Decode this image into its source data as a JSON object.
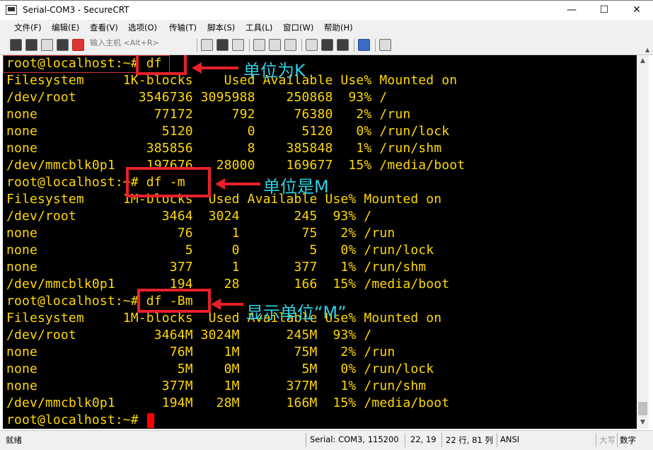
{
  "window": {
    "title": "Serial-COM3 - SecureCRT",
    "minimize_glyph": "—",
    "maximize_glyph": "☐",
    "close_glyph": "✕"
  },
  "menu": {
    "items": [
      {
        "label": "文件(F)"
      },
      {
        "label": "编辑(E)"
      },
      {
        "label": "查看(V)"
      },
      {
        "label": "选项(O)"
      },
      {
        "label": "传输(T)"
      },
      {
        "label": "脚本(S)"
      },
      {
        "label": "工具(L)"
      },
      {
        "label": "窗口(W)"
      },
      {
        "label": "帮助(H)"
      }
    ]
  },
  "toolbar": {
    "quick_connect_placeholder": "输入主机 <Alt+R>",
    "icons": [
      "connect-icon",
      "quick-connect-icon",
      "session-icon",
      "reconnect-icon",
      "disconnect-icon",
      "copy-icon",
      "paste-icon",
      "copy-paste-icon",
      "find-icon",
      "print-setup-icon",
      "print-icon",
      "session-options-icon",
      "global-options-icon",
      "keymap-icon",
      "help-icon",
      "sftp-icon"
    ]
  },
  "terminal": {
    "lines": [
      "root@localhost:~# df",
      "Filesystem     1K-blocks    Used Available Use% Mounted on",
      "/dev/root        3546736 3095988    250868  93% /",
      "none               77172     792     76380   2% /run",
      "none                5120       0      5120   0% /run/lock",
      "none              385856       8    385848   1% /run/shm",
      "/dev/mmcblk0p1    197676   28000    169677  15% /media/boot",
      "root@localhost:~# df -m",
      "Filesystem     1M-blocks  Used Available Use% Mounted on",
      "/dev/root           3464  3024       245  93% /",
      "none                  76     1        75   2% /run",
      "none                   5     0         5   0% /run/lock",
      "none                 377     1       377   1% /run/shm",
      "/dev/mmcblk0p1       194    28       166  15% /media/boot",
      "root@localhost:~# df -Bm",
      "Filesystem     1M-blocks  Used Available Use% Mounted on",
      "/dev/root          3464M 3024M      245M  93% /",
      "none                 76M    1M       75M   2% /run",
      "none                  5M    0M        5M   0% /run/lock",
      "none                377M    1M      377M   1% /run/shm",
      "/dev/mmcblk0p1      194M   28M      166M  15% /media/boot",
      "root@localhost:~# "
    ],
    "text_color": "#ffd800",
    "background": "#000000",
    "cursor_color": "#ff0000"
  },
  "annotations": {
    "label_1": "单位为K",
    "label_2": "单位是M",
    "label_3": "显示单位“M”",
    "box_color": "#e8202a",
    "label_color": "#2fd0e6"
  },
  "status": {
    "ready": "就绪",
    "serial": "Serial: COM3, 115200",
    "position": "22,  19",
    "size": "22 行, 81 列",
    "encoding": "ANSI",
    "caps": "大写",
    "num": "数字"
  }
}
